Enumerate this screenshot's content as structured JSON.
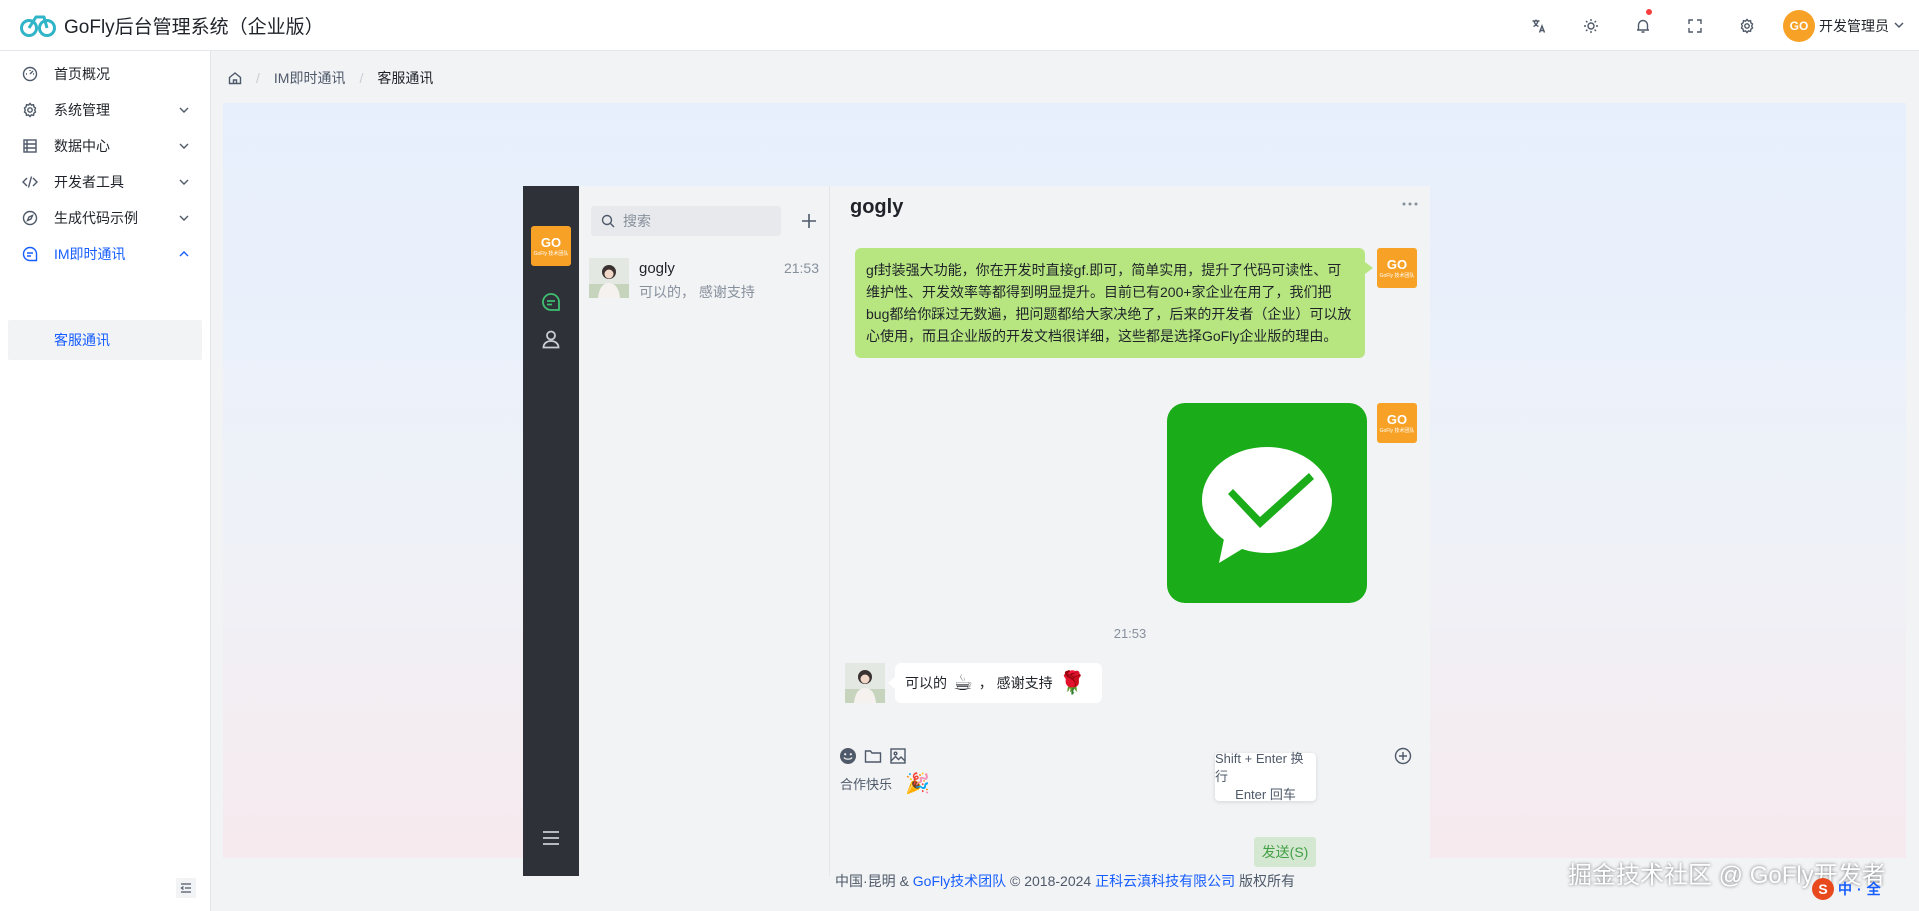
{
  "app": {
    "title": "GoFly后台管理系统（企业版）",
    "accent_color": "#165dff",
    "brand_color": "#2fb4c8"
  },
  "header": {
    "icons": [
      "translate-icon",
      "theme-icon",
      "bell-icon",
      "fullscreen-icon",
      "gear-icon"
    ],
    "user": {
      "avatar_text": "GO",
      "name": "开发管理员"
    }
  },
  "sidebar": {
    "items": [
      {
        "label": "首页概况",
        "icon": "dashboard-icon"
      },
      {
        "label": "系统管理",
        "icon": "gear-icon"
      },
      {
        "label": "数据中心",
        "icon": "database-icon"
      },
      {
        "label": "开发者工具",
        "icon": "code-icon"
      },
      {
        "label": "生成代码示例",
        "icon": "compass-icon"
      },
      {
        "label": "IM即时通讯",
        "icon": "chat-icon"
      }
    ],
    "active_sub": "客服通讯"
  },
  "breadcrumb": [
    "IM即时通讯",
    "客服通讯"
  ],
  "chat": {
    "rail_logo": {
      "main": "GO",
      "sub": "GoFly 技术团队"
    },
    "search_placeholder": "搜索",
    "contacts": [
      {
        "name": "gogly",
        "time": "21:53",
        "preview": "可以的， 感谢支持"
      }
    ],
    "conversation": {
      "title": "gogly",
      "self_message": "gf封装强大功能，你在开发时直接gf.即可，简单实用，提升了代码可读性、可维护性、开发效率等都得到明显提升。目前已有200+家企业在用了，我们把bug都给你踩过无数遍，把问题都给大家决绝了，后来的开发者（企业）可以放心使用，而且企业版的开发文档很详细，这些都是选择GoFly企业版的理由。",
      "time": "21:53",
      "other_message": {
        "part1": "可以的",
        "emoji1": "☕",
        "part2": "， 感谢支持",
        "emoji2": "🌹"
      }
    },
    "composer": {
      "text": "合作快乐",
      "emoji": "🎉",
      "hint_line1": "Shift + Enter 换行",
      "hint_line2": "Enter 回车",
      "send_label": "发送(S)"
    }
  },
  "footer": {
    "prefix": "中国·昆明 &",
    "team": "GoFly技术团队",
    "copyright": "© 2018-2024",
    "company": "正科云滇科技有限公司",
    "suffix": "版权所有"
  },
  "watermark": "掘金技术社区 @ GoFly开发者",
  "ime": {
    "logo": "S",
    "mode": "中",
    "punct": "·",
    "width": "全"
  }
}
